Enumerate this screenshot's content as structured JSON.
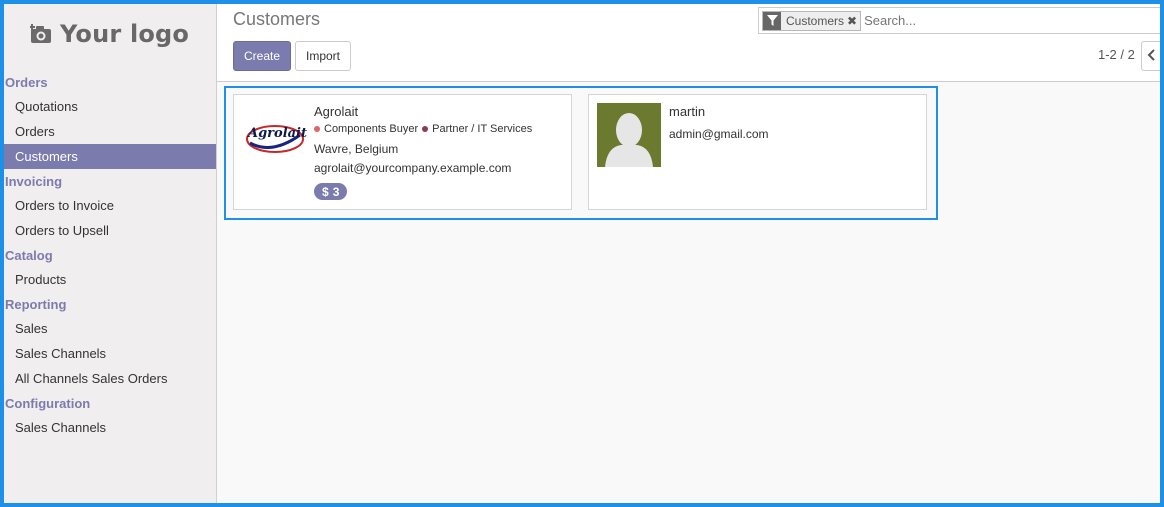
{
  "logo": {
    "text": "Your logo",
    "icon": "camera-icon"
  },
  "sidebar": {
    "sections": [
      {
        "label": "Orders",
        "items": [
          "Quotations",
          "Orders",
          "Customers"
        ]
      },
      {
        "label": "Invoicing",
        "items": [
          "Orders to Invoice",
          "Orders to Upsell"
        ]
      },
      {
        "label": "Catalog",
        "items": [
          "Products"
        ]
      },
      {
        "label": "Reporting",
        "items": [
          "Sales",
          "Sales Channels",
          "All Channels Sales Orders"
        ]
      },
      {
        "label": "Configuration",
        "items": [
          "Sales Channels"
        ]
      }
    ],
    "active_item": "Customers"
  },
  "header": {
    "title": "Customers",
    "create_label": "Create",
    "import_label": "Import"
  },
  "search": {
    "facet_icon": "filter-icon",
    "facet_value": "Customers",
    "facet_remove": "✖",
    "placeholder": "Search..."
  },
  "pager": {
    "text": "1-2 / 2",
    "prev_icon": "chevron-left-icon"
  },
  "cards": [
    {
      "name": "Agrolait",
      "logo_text": "Agrolait",
      "tags": [
        {
          "label": "Components Buyer",
          "color": "#e06666"
        },
        {
          "label": "Partner / IT Services",
          "color": "#8b3a5a"
        }
      ],
      "location": "Wavre, Belgium",
      "email": "agrolait@yourcompany.example.com",
      "badge": {
        "icon": "dollar-icon",
        "symbol": "$",
        "count": "3"
      }
    },
    {
      "name": "martin",
      "email": "admin@gmail.com",
      "avatar": "default-avatar-icon"
    }
  ],
  "colors": {
    "accent": "#7c7bad",
    "highlight": "#1e90e8",
    "avatar_bg": "#6b7a2e"
  }
}
